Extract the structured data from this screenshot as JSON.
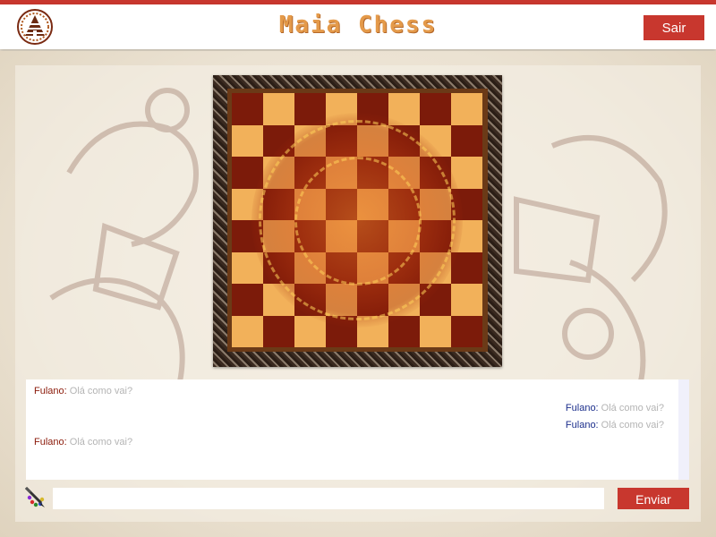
{
  "header": {
    "title": "Maia Chess",
    "logout_label": "Sair",
    "logo_icon": "pyramid-emblem-icon"
  },
  "colors": {
    "accent": "#c8372e",
    "title": "#e49a4a",
    "board_light": "#f2b15a",
    "board_dark": "#7c1b0a",
    "sender_self": "#8b1a0a",
    "sender_other": "#1c2f8c"
  },
  "chat": {
    "messages": [
      {
        "sender": "Fulano:",
        "text": " Olá como vai?",
        "side": "left"
      },
      {
        "sender": "Fulano:",
        "text": " Olá como vai?",
        "side": "right"
      },
      {
        "sender": "Fulano:",
        "text": " Olá como vai?",
        "side": "right"
      },
      {
        "sender": "Fulano:",
        "text": " Olá como vai?",
        "side": "left"
      }
    ],
    "input_value": "",
    "input_placeholder": "",
    "send_label": "Enviar",
    "tool_icon": "pencil-palette-icon"
  },
  "board": {
    "rows": 8,
    "cols": 8
  }
}
